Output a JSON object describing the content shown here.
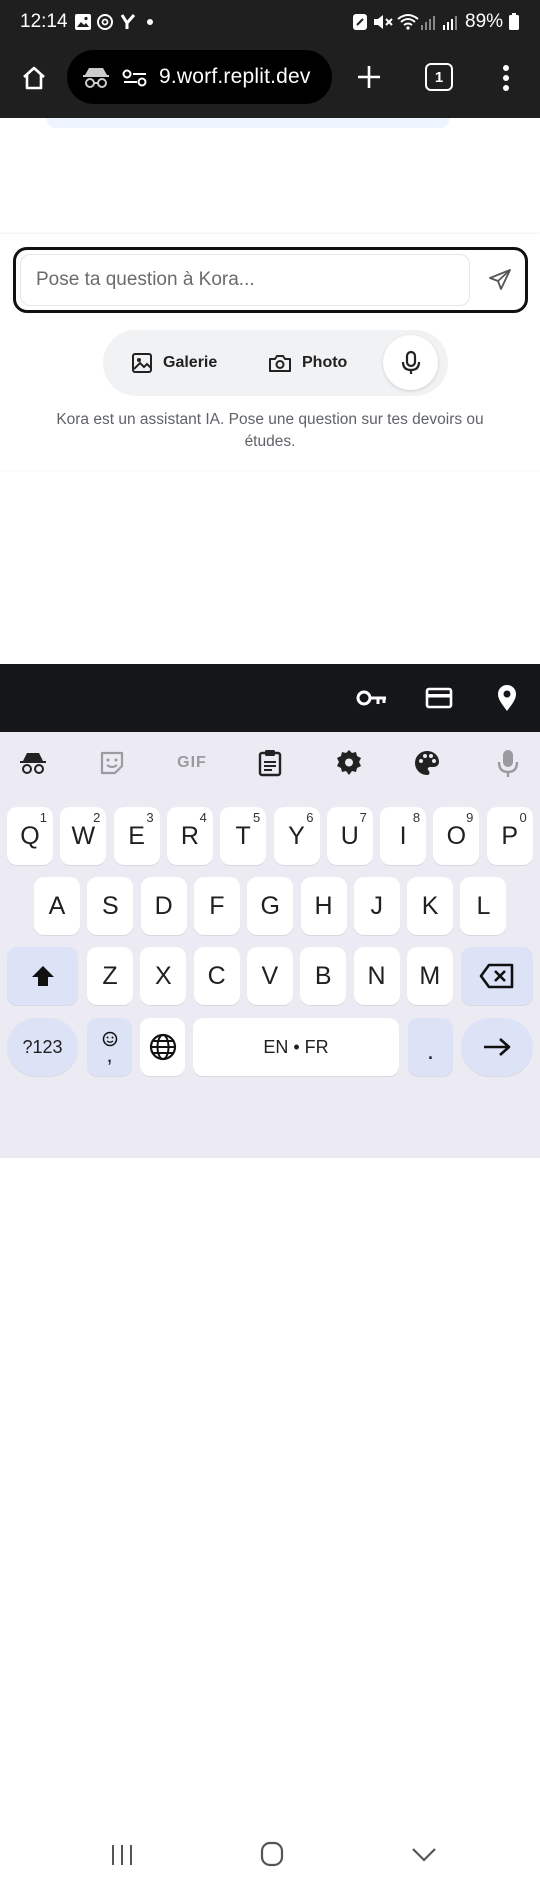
{
  "status_bar": {
    "time": "12:14",
    "battery": "89%"
  },
  "browser": {
    "url": "9.worf.replit.dev",
    "tab_count": "1"
  },
  "chat": {
    "input_placeholder": "Pose ta question à Kora...",
    "gallery_label": "Galerie",
    "photo_label": "Photo",
    "disclaimer": "Kora est un assistant IA. Pose une question sur tes devoirs ou études."
  },
  "keyboard": {
    "toolbar": {
      "gif_label": "GIF"
    },
    "row1": [
      {
        "key": "Q",
        "hint": "1"
      },
      {
        "key": "W",
        "hint": "2"
      },
      {
        "key": "E",
        "hint": "3"
      },
      {
        "key": "R",
        "hint": "4"
      },
      {
        "key": "T",
        "hint": "5"
      },
      {
        "key": "Y",
        "hint": "6"
      },
      {
        "key": "U",
        "hint": "7"
      },
      {
        "key": "I",
        "hint": "8"
      },
      {
        "key": "O",
        "hint": "9"
      },
      {
        "key": "P",
        "hint": "0"
      }
    ],
    "row2": [
      "A",
      "S",
      "D",
      "F",
      "G",
      "H",
      "J",
      "K",
      "L"
    ],
    "row3": [
      "Z",
      "X",
      "C",
      "V",
      "B",
      "N",
      "M"
    ],
    "symbols_label": "?123",
    "comma_label": ",",
    "space_label": "EN • FR",
    "period_label": "."
  },
  "colors": {
    "status_bar_bg": "#1f1f1f",
    "accessory_bar_bg": "#141619",
    "keyboard_bg": "#eceaf2",
    "function_key_bg": "#dde3f7",
    "input_border": "#111111"
  }
}
